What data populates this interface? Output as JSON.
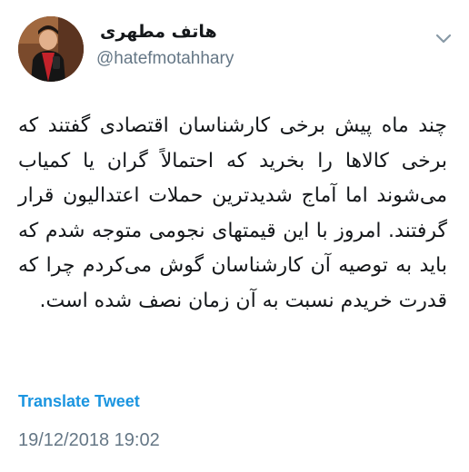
{
  "user": {
    "display_name": "هاتف مطهری",
    "handle": "@hatefmotahhary",
    "avatar_icon": "profile-photo"
  },
  "menu": {
    "icon": "chevron-down-icon"
  },
  "tweet": {
    "text": "چند ماه پیش برخی کارشناسان اقتصادی گفتند که برخی کالاها را بخرید که احتمالاً گران یا کمیاب می‌شوند اما آماج شدیدترین حملات اعتدالیون قرار گرفتند. امروز با این قیمتهای نجومی متوجه شدم که باید به توصیه آن کارشناسان گوش می‌کردم چرا که قدرت خریدم نسبت به آن زمان نصف شده است.",
    "translate_label": "Translate Tweet",
    "timestamp": "19/12/2018 19:02"
  },
  "colors": {
    "link": "#1b95e0",
    "secondary_text": "#657786",
    "primary_text": "#14171a"
  }
}
